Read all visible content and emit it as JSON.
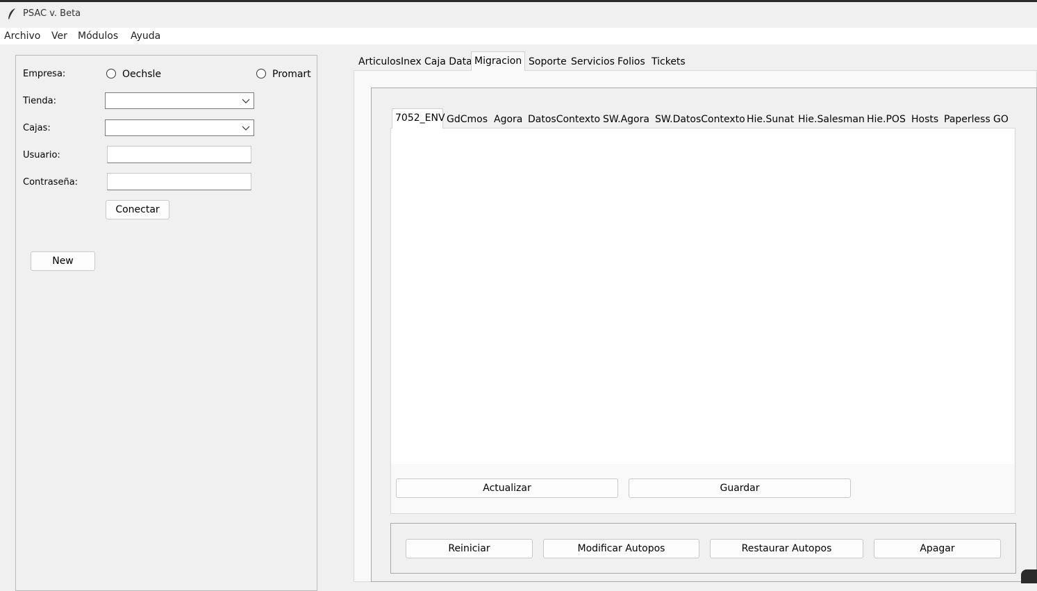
{
  "window": {
    "title": "PSAC v. Beta"
  },
  "menu": {
    "items": [
      "Archivo",
      "Ver",
      "Módulos",
      "Ayuda"
    ]
  },
  "form": {
    "empresa_label": "Empresa:",
    "radio_oechsle": "Oechsle",
    "radio_promart": "Promart",
    "tienda_label": "Tienda:",
    "tienda_value": "",
    "cajas_label": "Cajas:",
    "cajas_value": "",
    "usuario_label": "Usuario:",
    "usuario_value": "",
    "password_label": "Contraseña:",
    "password_value": "",
    "connect_label": "Conectar",
    "new_label": "New"
  },
  "tabs": [
    "ArticulosInex",
    "Caja Data",
    "Migracion",
    "Soporte",
    "Servicios",
    "Folios",
    "Tickets"
  ],
  "selected_tab": "Migracion",
  "subtabs": [
    "7052_ENV",
    "GdCmos",
    "Agora",
    "DatosContexto",
    "SW.Agora",
    "SW.DatosContexto",
    "Hie.Sunat",
    "Hie.Salesman",
    "Hie.POS",
    "Hosts",
    "Paperless",
    "GO"
  ],
  "selected_subtab": "7052_ENV",
  "editor": {
    "content": ""
  },
  "actions": {
    "update_label": "Actualizar",
    "save_label": "Guardar"
  },
  "bottom_actions": {
    "restart_label": "Reiniciar",
    "modify_label": "Modificar Autopos",
    "restore_label": "Restaurar Autopos",
    "shutdown_label": "Apagar"
  }
}
